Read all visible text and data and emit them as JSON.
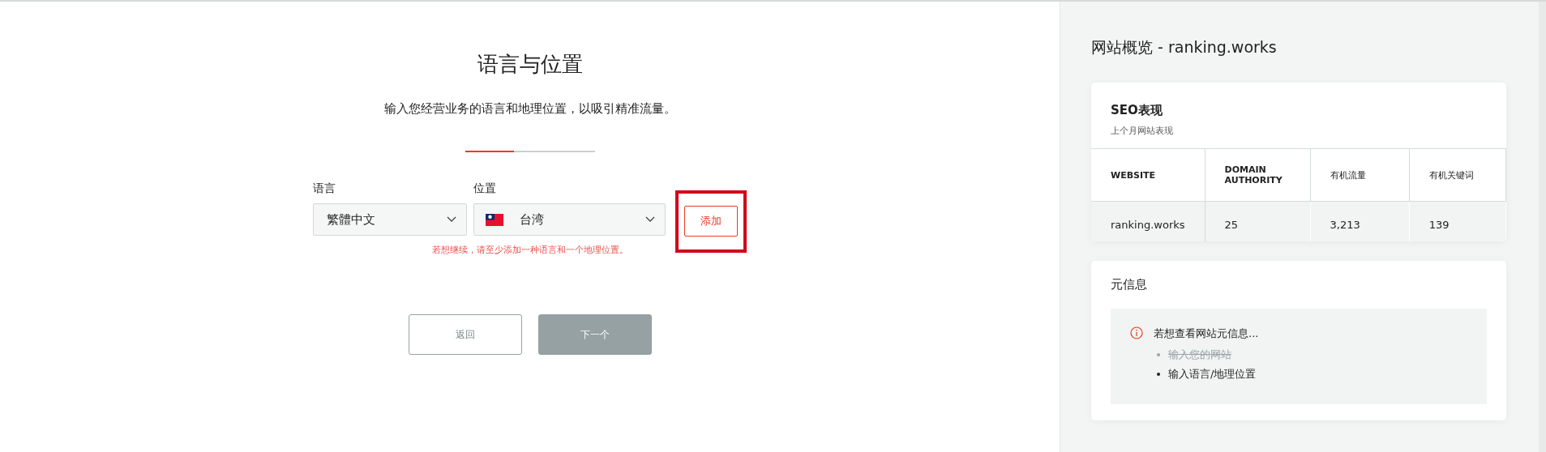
{
  "form": {
    "title": "语言与位置",
    "subtitle": "输入您经营业务的语言和地理位置，以吸引精准流量。",
    "progress": {
      "level": 0.38
    },
    "language": {
      "label": "语言",
      "value": "繁體中文"
    },
    "location": {
      "label": "位置",
      "value": "台湾"
    },
    "add_button": {
      "label": "添加",
      "highlighted": true
    },
    "error": "若想继续，请至少添加一种语言和一个地理位置。",
    "back_button": {
      "label": "返回"
    },
    "next_button": {
      "label": "下一个",
      "disabled": true
    }
  },
  "sidebar": {
    "title": "网站概览 - ranking.works",
    "seo": {
      "title": "SEO表现",
      "subtitle": "上个月网站表现",
      "columns": [
        "WEBSITE",
        "DOMAIN AUTHORITY",
        "有机流量",
        "有机关键词"
      ],
      "rows": [
        [
          "ranking.works",
          "25",
          "3,213",
          "139"
        ]
      ]
    },
    "meta": {
      "title": "元信息",
      "heading": "若想查看网站元信息...",
      "steps": [
        {
          "text": "输入您的网站",
          "done": true
        },
        {
          "text": "输入语言/地理位置",
          "done": false
        }
      ]
    }
  }
}
